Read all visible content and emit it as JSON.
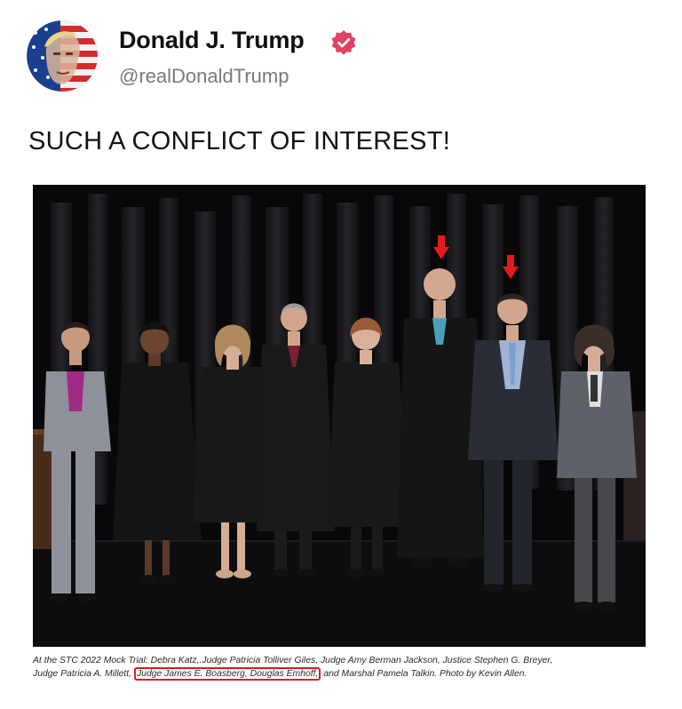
{
  "post": {
    "author_name": "Donald J. Trump",
    "author_handle": "@realDonaldTrump",
    "verified": true,
    "text": "SUCH A CONFLICT OF INTEREST!",
    "caption": {
      "line1": "At the STC 2022 Mock Trial: Debra Katz,.Judge Patricia Tolliver Giles, Judge Amy Berman Jackson, Justice Stephen G. Breyer,",
      "line2_start": "Judge Patricia A. Millett,",
      "line2_highlight": "Judge James E. Boasberg, Douglas Emhoff,",
      "line2_end": "and Marshal Pamela Talkin. Photo by Kevin Allen."
    }
  },
  "colors": {
    "verified_badge": "#e4405f",
    "highlight_outline": "#e01a1a",
    "arrow": "#e31b1b"
  },
  "icons": {
    "verified": "verified-badge-icon",
    "avatar": "avatar-image"
  }
}
